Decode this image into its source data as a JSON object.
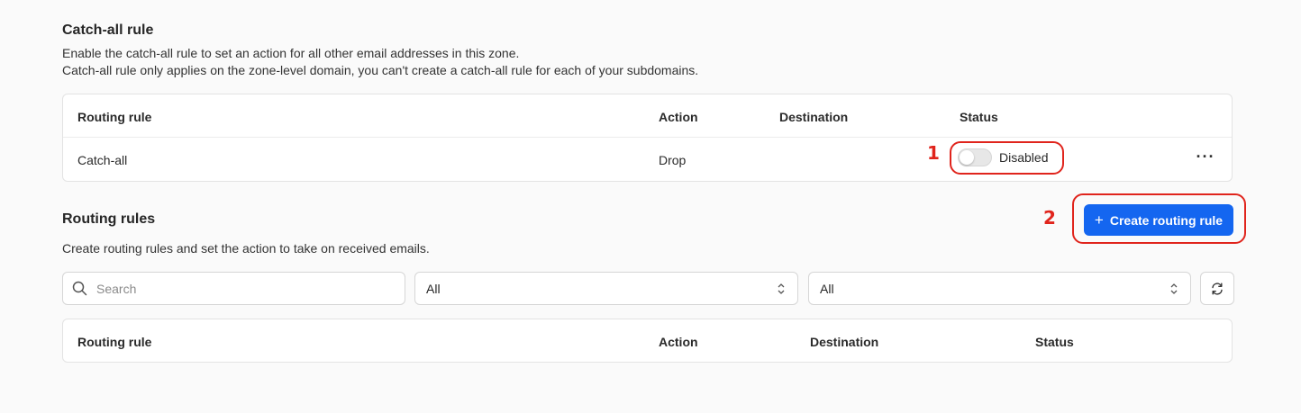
{
  "catch_all": {
    "title": "Catch-all rule",
    "desc_line1": "Enable the catch-all rule to set an action for all other email addresses in this zone.",
    "desc_line2": "Catch-all rule only applies on the zone-level domain, you can't create a catch-all rule for each of your subdomains.",
    "table": {
      "headers": [
        "Routing rule",
        "Action",
        "Destination",
        "Status"
      ],
      "row": {
        "rule": "Catch-all",
        "action": "Drop",
        "destination": "",
        "status": "Disabled",
        "enabled": false,
        "menu": "···"
      }
    }
  },
  "routing_rules": {
    "title": "Routing rules",
    "desc": "Create routing rules and set the action to take on received emails.",
    "create_button": "Create routing rule",
    "search_placeholder": "Search",
    "filter1_value": "All",
    "filter2_value": "All",
    "table": {
      "headers": [
        "Routing rule",
        "Action",
        "Destination",
        "Status"
      ]
    }
  },
  "annotations": {
    "marker1": "1",
    "marker2": "2",
    "color": "#e0241c"
  },
  "colors": {
    "primary": "#1466f0",
    "background": "#fafafa"
  },
  "icons": [
    "plus-icon",
    "search-icon",
    "chevron-updown-icon",
    "refresh-icon",
    "more-horizontal-icon"
  ]
}
